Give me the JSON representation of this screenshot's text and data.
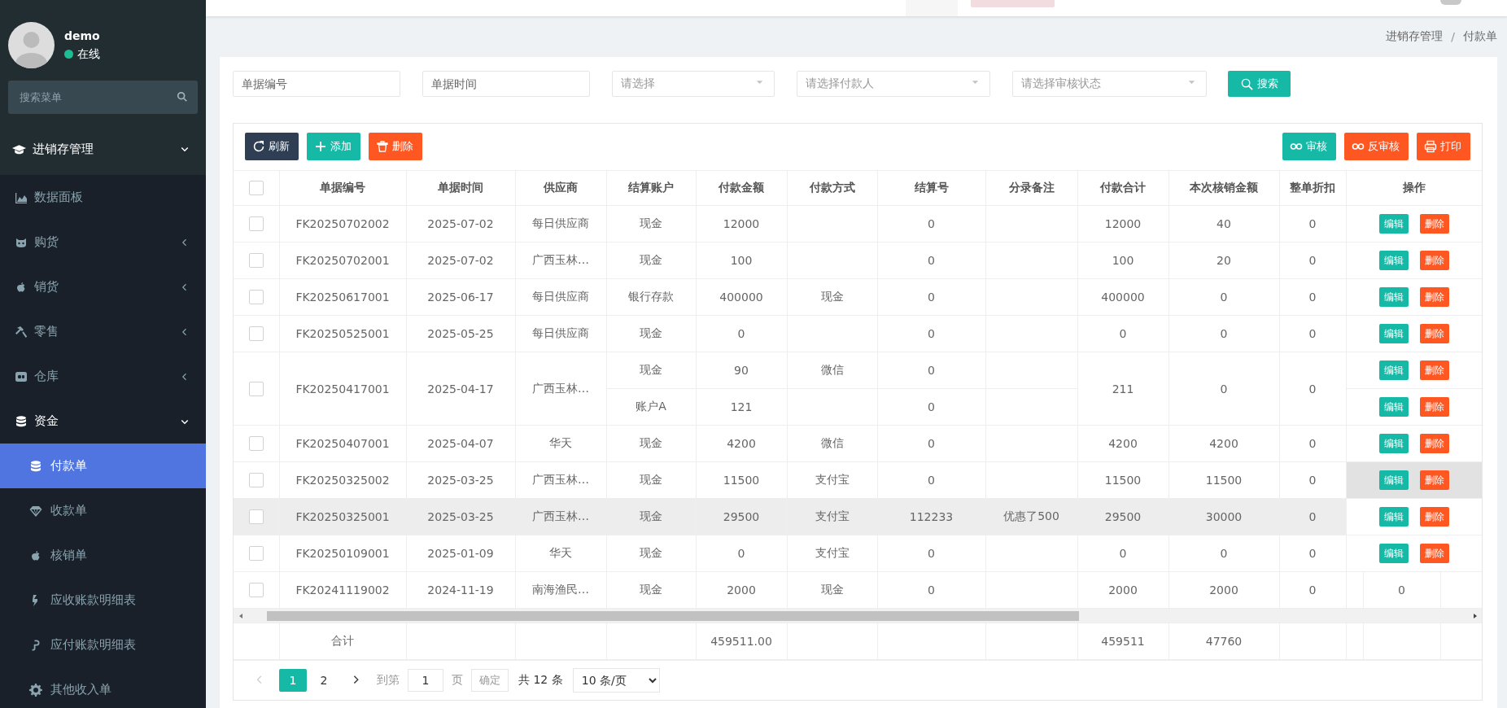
{
  "sidebar": {
    "user": {
      "name": "demo",
      "status": "在线",
      "online": true
    },
    "search": {
      "placeholder": "搜索菜单"
    },
    "menu": [
      {
        "label": "进销存管理",
        "expanded": true,
        "selected": false,
        "children": [
          {
            "label": "数据面板",
            "selected": false
          },
          {
            "label": "购货",
            "expanded": false,
            "selected": false
          },
          {
            "label": "销货",
            "expanded": false,
            "selected": false
          },
          {
            "label": "零售",
            "expanded": false,
            "selected": false
          },
          {
            "label": "仓库",
            "expanded": false,
            "selected": false
          },
          {
            "label": "资金",
            "expanded": true,
            "selected": false,
            "children": [
              {
                "label": "付款单",
                "selected": true
              },
              {
                "label": "收款单",
                "selected": false
              },
              {
                "label": "核销单",
                "selected": false
              },
              {
                "label": "应收账款明细表",
                "selected": false
              },
              {
                "label": "应付账款明细表",
                "selected": false
              },
              {
                "label": "其他收入单",
                "selected": false
              }
            ]
          }
        ]
      }
    ]
  },
  "breadcrumb": {
    "items": [
      "进销存管理",
      "付款单"
    ],
    "separator": "/"
  },
  "filters": [
    {
      "kind": "input",
      "placeholder": "单据编号"
    },
    {
      "kind": "input",
      "placeholder": "单据时间"
    },
    {
      "kind": "select",
      "placeholder": "请选择"
    },
    {
      "kind": "select",
      "placeholder": "请选择付款人"
    },
    {
      "kind": "select",
      "placeholder": "请选择审核状态"
    }
  ],
  "search_button": "搜索",
  "toolbar": {
    "left": [
      {
        "label": "刷新",
        "color": "#2f3e52"
      },
      {
        "label": "添加",
        "color": "#16b9a6"
      },
      {
        "label": "删除",
        "color": "#ff5722"
      }
    ],
    "right": [
      {
        "label": "审核",
        "color": "#16b9a6"
      },
      {
        "label": "反审核",
        "color": "#ff5722"
      },
      {
        "label": "打印",
        "color": "#ff5722"
      }
    ]
  },
  "table": {
    "all_selected": false,
    "columns": [
      "单据编号",
      "单据时间",
      "供应商",
      "结算账户",
      "付款金额",
      "付款方式",
      "结算号",
      "分录备注",
      "付款合计",
      "本次核销金额",
      "整单折扣",
      "操作"
    ],
    "rows": [
      {
        "number": "FK20250702002",
        "date": "2025-07-02",
        "supplier": "每日供应商",
        "lines": [
          {
            "account": "现金",
            "amount": "12000",
            "settlement_no": "0"
          }
        ],
        "total": "12000",
        "writeoff": "40",
        "discount": "0",
        "selected": false,
        "highlighted": false
      },
      {
        "number": "FK20250702001",
        "date": "2025-07-02",
        "supplier": "广西玉林…",
        "lines": [
          {
            "account": "现金",
            "amount": "100",
            "settlement_no": "0"
          }
        ],
        "total": "100",
        "writeoff": "20",
        "discount": "0",
        "selected": false,
        "highlighted": false
      },
      {
        "number": "FK20250617001",
        "date": "2025-06-17",
        "supplier": "每日供应商",
        "lines": [
          {
            "account": "银行存款",
            "amount": "400000",
            "method": "现金",
            "settlement_no": "0"
          }
        ],
        "total": "400000",
        "writeoff": "0",
        "discount": "0",
        "selected": false,
        "highlighted": false
      },
      {
        "number": "FK20250525001",
        "date": "2025-05-25",
        "supplier": "每日供应商",
        "lines": [
          {
            "account": "现金",
            "amount": "0",
            "settlement_no": "0"
          }
        ],
        "total": "0",
        "writeoff": "0",
        "discount": "0",
        "selected": false,
        "highlighted": false
      },
      {
        "number": "FK20250417001",
        "date": "2025-04-17",
        "supplier": "广西玉林…",
        "lines": [
          {
            "account": "现金",
            "amount": "90",
            "method": "微信",
            "settlement_no": "0"
          },
          {
            "account": "账户A",
            "amount": "121",
            "settlement_no": "0"
          }
        ],
        "total": "211",
        "writeoff": "0",
        "discount": "0",
        "selected": false,
        "highlighted": false
      },
      {
        "number": "FK20250407001",
        "date": "2025-04-07",
        "supplier": "华天",
        "lines": [
          {
            "account": "现金",
            "amount": "4200",
            "method": "微信",
            "settlement_no": "0"
          }
        ],
        "total": "4200",
        "writeoff": "4200",
        "discount": "0",
        "selected": false,
        "highlighted": false
      },
      {
        "number": "FK20250325002",
        "date": "2025-03-25",
        "supplier": "广西玉林…",
        "lines": [
          {
            "account": "现金",
            "amount": "11500",
            "method": "支付宝",
            "settlement_no": "0"
          }
        ],
        "total": "11500",
        "writeoff": "11500",
        "discount": "0",
        "selected": false,
        "highlighted": false
      },
      {
        "number": "FK20250325001",
        "date": "2025-03-25",
        "supplier": "广西玉林…",
        "lines": [
          {
            "account": "现金",
            "amount": "29500",
            "method": "支付宝",
            "settlement_no": "112233",
            "note": "优惠了500"
          }
        ],
        "total": "29500",
        "writeoff": "30000",
        "discount": "0",
        "selected": false,
        "highlighted": true
      },
      {
        "number": "FK20250109001",
        "date": "2025-01-09",
        "supplier": "华天",
        "lines": [
          {
            "account": "现金",
            "amount": "0",
            "method": "支付宝",
            "settlement_no": "0"
          }
        ],
        "total": "0",
        "writeoff": "0",
        "discount": "0",
        "selected": false,
        "highlighted": false
      },
      {
        "number": "FK20241119002",
        "date": "2024-11-19",
        "supplier": "南海渔民…",
        "lines": [
          {
            "account": "现金",
            "amount": "2000",
            "method": "现金",
            "settlement_no": "0"
          }
        ],
        "total": "2000",
        "writeoff": "2000",
        "discount": "0",
        "column_13": "0",
        "selected": false,
        "highlighted": false
      }
    ],
    "actions": [
      {
        "buttons": [
          "编辑",
          "删除"
        ],
        "highlighted": false
      },
      {
        "buttons": [
          "编辑",
          "删除"
        ],
        "highlighted": false
      },
      {
        "buttons": [
          "编辑",
          "删除"
        ],
        "highlighted": false
      },
      {
        "buttons": [
          "编辑",
          "删除"
        ],
        "highlighted": false
      },
      {
        "buttons": [
          "编辑",
          "删除"
        ],
        "highlighted": false
      },
      {
        "buttons": [
          "编辑",
          "删除"
        ],
        "highlighted": false
      },
      {
        "buttons": [
          "编辑",
          "删除"
        ],
        "highlighted": false
      },
      {
        "buttons": [
          "编辑",
          "删除"
        ],
        "highlighted": true
      },
      {
        "buttons": [
          "编辑",
          "删除"
        ],
        "highlighted": false
      },
      {
        "buttons": [
          "编辑",
          "删除"
        ],
        "highlighted": false
      }
    ],
    "footer": {
      "label": "合计",
      "amount": "459511.00",
      "total": "459511",
      "writeoff": "47760"
    }
  },
  "pagination": {
    "pages": [
      {
        "label": "1",
        "selected": true
      },
      {
        "label": "2",
        "selected": false
      }
    ],
    "goto_label": "到第",
    "goto_value": "1",
    "page_label": "页",
    "confirm": "确定",
    "total": "共 12 条",
    "page_size": "10 条/页"
  }
}
